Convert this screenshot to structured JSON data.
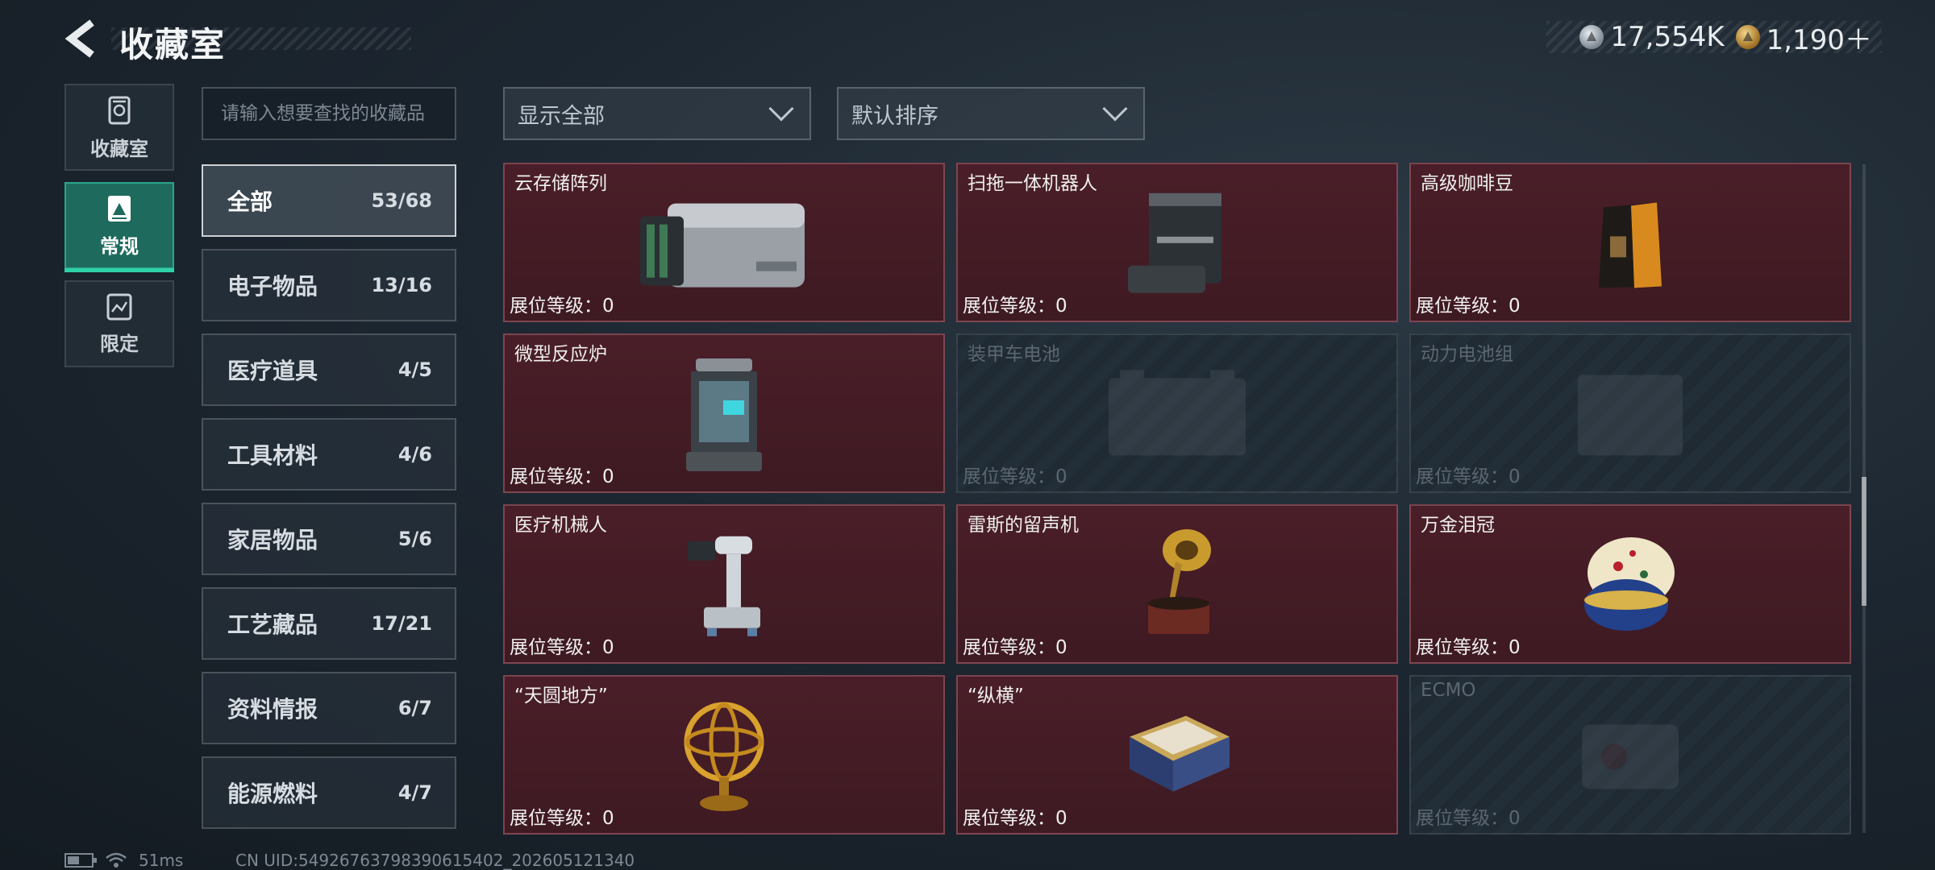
{
  "header": {
    "title": "收藏室",
    "currency": [
      {
        "icon": "silver-coin-icon",
        "value": "17,554K"
      },
      {
        "icon": "gold-coin-icon",
        "value": "1,190＋"
      }
    ]
  },
  "nav": [
    {
      "label": "收藏室",
      "icon": "collection-room-icon",
      "active": false
    },
    {
      "label": "常规",
      "icon": "regular-icon",
      "active": true
    },
    {
      "label": "限定",
      "icon": "limited-icon",
      "active": false
    }
  ],
  "search": {
    "placeholder": "请输入想要查找的收藏品"
  },
  "filters": {
    "display": "显示全部",
    "sort": "默认排序"
  },
  "categories": [
    {
      "name": "全部",
      "count": "53/68"
    },
    {
      "name": "电子物品",
      "count": "13/16"
    },
    {
      "name": "医疗道具",
      "count": "4/5"
    },
    {
      "name": "工具材料",
      "count": "4/6"
    },
    {
      "name": "家居物品",
      "count": "5/6"
    },
    {
      "name": "工艺藏品",
      "count": "17/21"
    },
    {
      "name": "资料情报",
      "count": "6/7"
    },
    {
      "name": "能源燃料",
      "count": "4/7"
    }
  ],
  "items": [
    {
      "name": "云存储阵列",
      "level": "展位等级：0",
      "owned": true,
      "icon": "server-array-icon"
    },
    {
      "name": "扫拖一体机器人",
      "level": "展位等级：0",
      "owned": true,
      "icon": "robot-vacuum-icon"
    },
    {
      "name": "高级咖啡豆",
      "level": "展位等级：0",
      "owned": true,
      "icon": "coffee-bag-icon"
    },
    {
      "name": "微型反应炉",
      "level": "展位等级：0",
      "owned": true,
      "icon": "reactor-icon"
    },
    {
      "name": "装甲车电池",
      "level": "展位等级：0",
      "owned": false,
      "icon": "battery-box-icon"
    },
    {
      "name": "动力电池组",
      "level": "展位等级：0",
      "owned": false,
      "icon": "battery-pack-icon"
    },
    {
      "name": "医疗机械人",
      "level": "展位等级：0",
      "owned": true,
      "icon": "medical-robot-icon"
    },
    {
      "name": "雷斯的留声机",
      "level": "展位等级：0",
      "owned": true,
      "icon": "gramophone-icon"
    },
    {
      "name": "万金泪冠",
      "level": "展位等级：0",
      "owned": true,
      "icon": "jeweled-egg-icon"
    },
    {
      "name": "“天圆地方”",
      "level": "展位等级：0",
      "owned": true,
      "icon": "armillary-sphere-icon"
    },
    {
      "name": "“纵横”",
      "level": "展位等级：0",
      "owned": true,
      "icon": "chess-box-icon"
    },
    {
      "name": "ECMO",
      "level": "展位等级：0",
      "owned": false,
      "icon": "ecmo-machine-icon"
    }
  ],
  "footer": {
    "ping": "51ms",
    "uid": "CN UID:54926763798390615402_202605121340"
  },
  "colors": {
    "owned_card": "#4a1e28",
    "active_nav": "#1e6b5e",
    "accent": "#2fd0a8"
  }
}
